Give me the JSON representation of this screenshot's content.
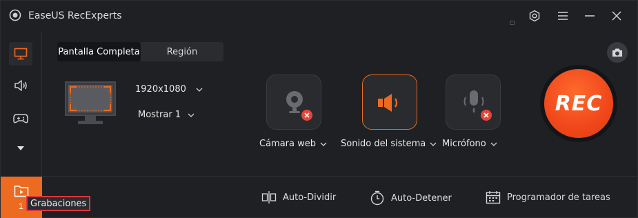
{
  "app": {
    "title": "EaseUS RecExperts",
    "version": "☐"
  },
  "titlebar": {
    "icons": [
      "settings-icon",
      "menu-icon",
      "minimize-icon",
      "close-icon"
    ]
  },
  "sidebar": {
    "items": [
      {
        "name": "screen",
        "icon": "monitor-icon",
        "active": true
      },
      {
        "name": "audio",
        "icon": "speaker-icon",
        "active": false
      },
      {
        "name": "game",
        "icon": "gamepad-icon",
        "active": false
      },
      {
        "name": "more",
        "icon": "triangle-down-icon",
        "active": false
      }
    ],
    "recordings": {
      "count": "1",
      "tooltip": "Grabaciones"
    }
  },
  "tabs": [
    {
      "label": "Pantalla Completa",
      "active": true
    },
    {
      "label": "Región",
      "active": false
    }
  ],
  "capture": {
    "resolution": "1920x1080",
    "display": "Mostrar 1"
  },
  "sources": [
    {
      "label": "Cámara web",
      "icon": "webcam-icon",
      "enabled": false
    },
    {
      "label": "Sonido del sistema",
      "icon": "speaker-icon",
      "enabled": true
    },
    {
      "label": "Micrófono",
      "icon": "microphone-icon",
      "enabled": false
    }
  ],
  "rec_button": {
    "label": "REC"
  },
  "bottombar": {
    "auto_split": "Auto-Dividir",
    "auto_stop": "Auto-Detener",
    "scheduler": "Programador de tareas"
  },
  "colors": {
    "accent": "#ed6b21",
    "rec": "#f0471a",
    "badge": "#e2473b",
    "background": "#1f2023"
  }
}
